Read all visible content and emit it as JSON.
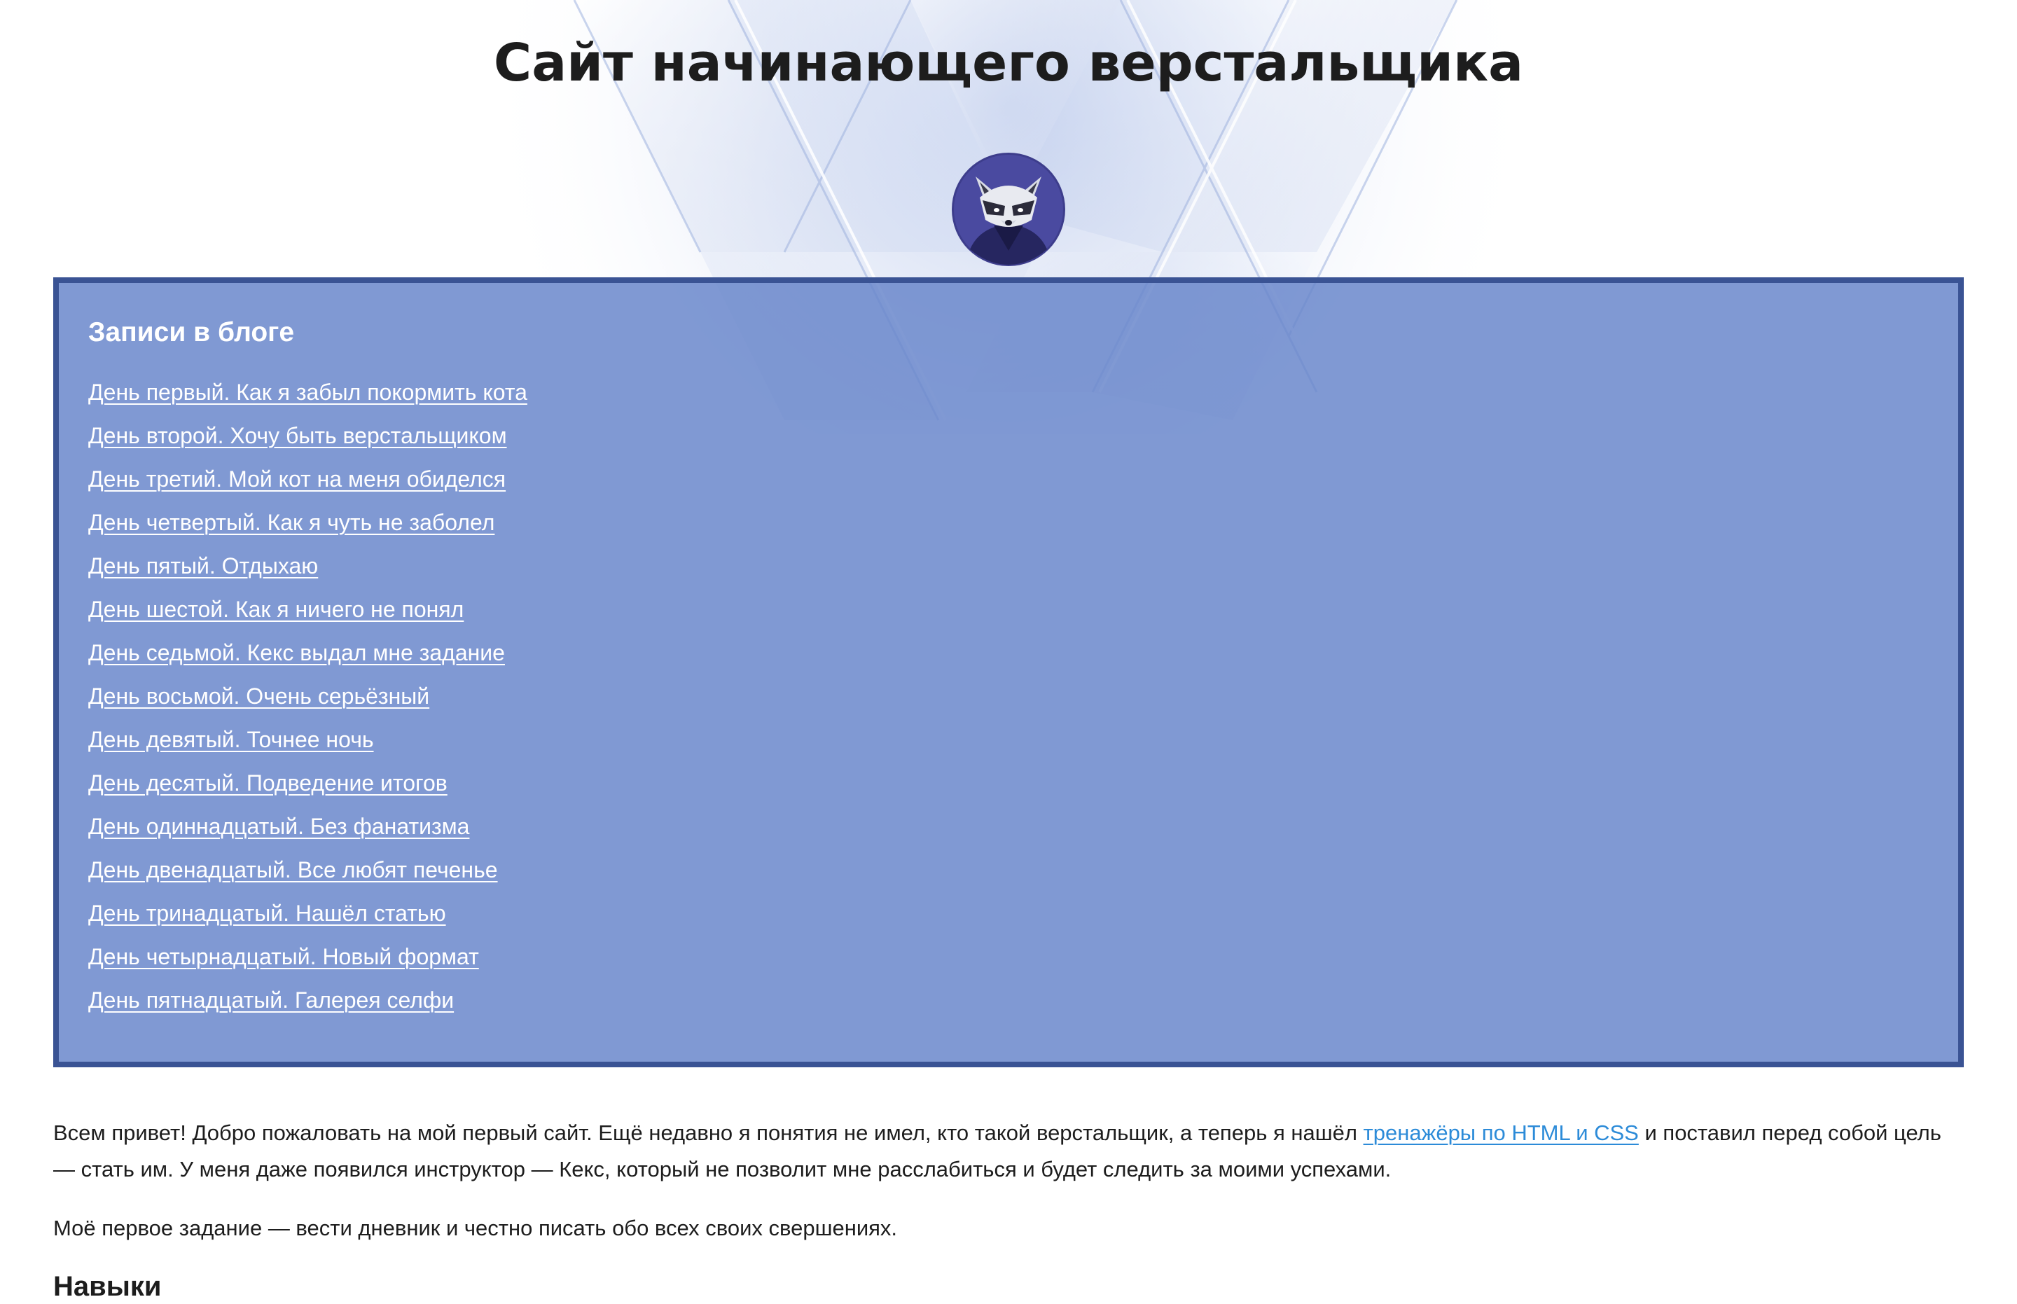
{
  "header": {
    "title": "Сайт начинающего верстальщика",
    "avatar_icon": "raccoon-avatar-icon"
  },
  "blog": {
    "title": "Записи в блоге",
    "posts": [
      "День первый. Как я забыл покормить кота",
      "День второй. Хочу быть верстальщиком",
      "День третий. Мой кот на меня обиделся",
      "День четвертый. Как я чуть не заболел",
      "День пятый. Отдыхаю",
      "День шестой. Как я ничего не понял",
      "День седьмой. Кекс выдал мне задание",
      "День восьмой. Очень серьёзный",
      "День девятый. Точнее ночь",
      "День десятый. Подведение итогов",
      "День одиннадцатый. Без фанатизма",
      "День двенадцатый. Все любят печенье",
      "День тринадцатый. Нашёл статью",
      "День четырнадцатый. Новый формат",
      "День пятнадцатый. Галерея селфи"
    ]
  },
  "intro": {
    "before_link": "Всем привет! Добро пожаловать на мой первый сайт. Ещё недавно я понятия не имел, кто такой верстальщик, а теперь я нашёл ",
    "link_text": "тренажёры по HTML и CSS",
    "after_link": " и поставил перед собой цель — стать им. У меня даже появился инструктор — Кекс, который не позволит мне расслабиться и будет следить за моими успехами.",
    "task": "Моё первое задание — вести дневник и честно писать обо всех своих свершениях."
  },
  "skills": {
    "title": "Навыки"
  },
  "colors": {
    "blog_background": "#8099d0",
    "blog_border": "#3a5394",
    "link": "#2c8bd8",
    "text": "#1d1d1d"
  }
}
